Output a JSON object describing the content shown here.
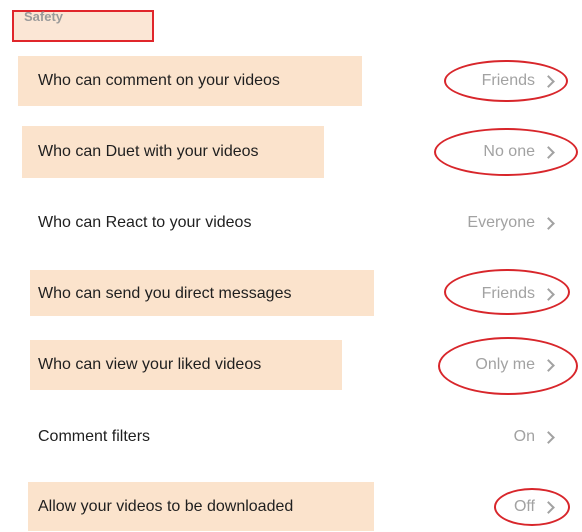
{
  "section": {
    "title": "Safety"
  },
  "settings": [
    {
      "label": "Who can comment on your videos",
      "value": "Friends"
    },
    {
      "label": "Who can Duet with your videos",
      "value": "No one"
    },
    {
      "label": "Who can React to your videos",
      "value": "Everyone"
    },
    {
      "label": "Who can send you direct messages",
      "value": "Friends"
    },
    {
      "label": "Who can view your liked videos",
      "value": "Only me"
    },
    {
      "label": "Comment filters",
      "value": "On"
    },
    {
      "label": "Allow your videos to be downloaded",
      "value": "Off"
    }
  ],
  "colors": {
    "highlight": "#fbe3cc",
    "annotation": "#d8262b",
    "value_text": "#a2a2a2"
  },
  "icons": {
    "chevron": "chevron-right-icon"
  }
}
